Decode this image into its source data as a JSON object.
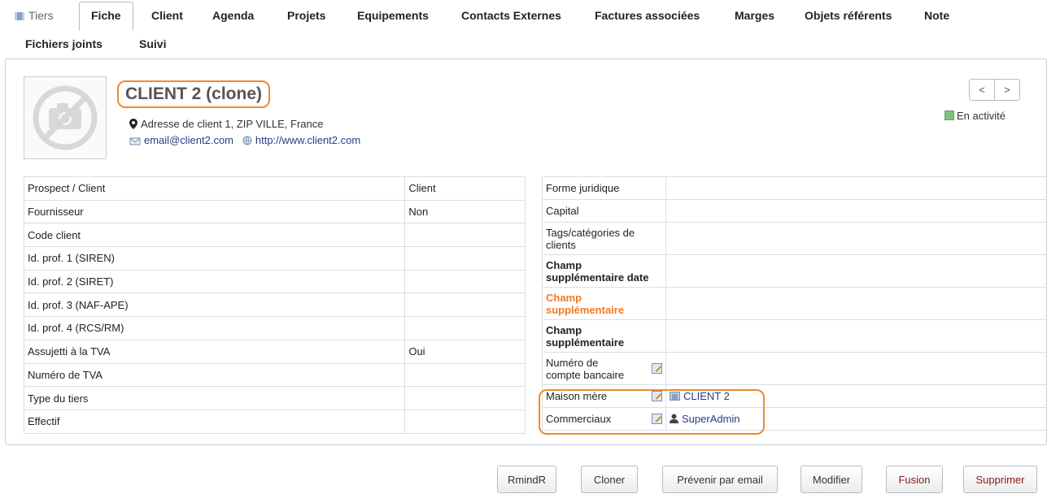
{
  "tabs": {
    "tiers": "Tiers",
    "fiche": "Fiche",
    "client": "Client",
    "agenda": "Agenda",
    "projets": "Projets",
    "equipements": "Equipements",
    "contacts_externes": "Contacts Externes",
    "factures_associees": "Factures associées",
    "marges": "Marges",
    "objets_referents": "Objets référents",
    "note": "Note",
    "fichiers_joints": "Fichiers joints",
    "suivi": "Suivi"
  },
  "header": {
    "name": "CLIENT 2 (clone)",
    "address": "Adresse de client 1, ZIP VILLE, France",
    "email": "email@client2.com",
    "website": "http://www.client2.com",
    "status": "En activité",
    "prev": "<",
    "next": ">"
  },
  "left_fields": [
    {
      "label": "Prospect / Client",
      "value": "Client"
    },
    {
      "label": "Fournisseur",
      "value": "Non"
    },
    {
      "label": "Code client",
      "value": ""
    },
    {
      "label": "Id. prof. 1 (SIREN)",
      "value": ""
    },
    {
      "label": "Id. prof. 2 (SIRET)",
      "value": ""
    },
    {
      "label": "Id. prof. 3 (NAF-APE)",
      "value": ""
    },
    {
      "label": "Id. prof. 4 (RCS/RM)",
      "value": ""
    },
    {
      "label": "Assujetti à la TVA",
      "value": "Oui"
    },
    {
      "label": "Numéro de TVA",
      "value": ""
    },
    {
      "label": "Type du tiers",
      "value": ""
    },
    {
      "label": "Effectif",
      "value": ""
    }
  ],
  "right_fields": {
    "forme_juridique": "Forme juridique",
    "capital": "Capital",
    "tags": "Tags/catégories de clients",
    "extra_date": "Champ supplémentaire date",
    "extra_orange": "Champ supplémentaire",
    "extra": "Champ supplémentaire",
    "compte_bancaire": "Numéro de compte bancaire",
    "maison_mere": "Maison mère",
    "maison_mere_value": "CLIENT 2",
    "commerciaux": "Commerciaux",
    "commerciaux_value": "SuperAdmin"
  },
  "actions": {
    "rmindr": "RmindR",
    "cloner": "Cloner",
    "prevenir": "Prévenir par email",
    "modifier": "Modifier",
    "fusion": "Fusion",
    "supprimer": "Supprimer"
  },
  "colors": {
    "highlight": "#ef8a2f",
    "link": "#263c80",
    "status_active": "#80c080"
  }
}
